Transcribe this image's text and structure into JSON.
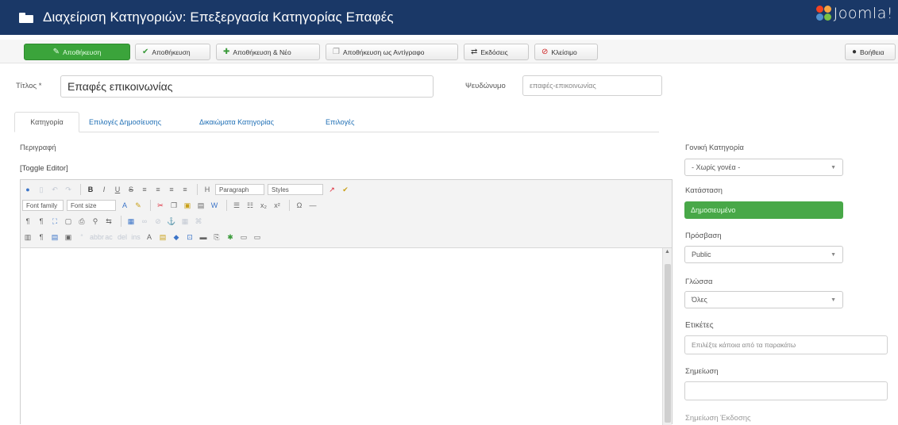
{
  "header": {
    "title": "Διαχείριση Κατηγοριών: Επεξεργασία Κατηγορίας Επαφές",
    "brand": "Joomla!"
  },
  "toolbar": {
    "save": "Αποθήκευση",
    "save_close": "Αποθήκευση",
    "save_new": "Αποθήκευση & Νέο",
    "save_copy": "Αποθήκευση ως Αντίγραφο",
    "versions": "Εκδόσεις",
    "close": "Κλείσιμο",
    "help": "Βοήθεια"
  },
  "form": {
    "title_label": "Τίτλος *",
    "title_value": "Επαφές επικοινωνίας",
    "alias_label": "Ψευδώνυμο",
    "alias_value": "επαφές-επικοινωνίας"
  },
  "tabs": [
    "Κατηγορία",
    "Επιλογές Δημοσίευσης",
    "Δικαιώματα Κατηγορίας",
    "Επιλογές"
  ],
  "editor": {
    "description_label": "Περιγραφή",
    "toggle_label": "[Toggle Editor]",
    "paragraph": "Paragraph",
    "styles": "Styles",
    "font_family": "Font family",
    "font_size": "Font size"
  },
  "sidebar": {
    "parent_label": "Γονική Κατηγορία",
    "parent_value": "- Χωρίς γονέα -",
    "status_label": "Κατάσταση",
    "status_value": "Δημοσιευμένο",
    "access_label": "Πρόσβαση",
    "access_value": "Public",
    "language_label": "Γλώσσα",
    "language_value": "Όλες",
    "tags_label": "Ετικέτες",
    "tags_placeholder": "Επιλέξτε κάποια από τα παρακάτω",
    "note_label": "Σημείωση",
    "version_note_label": "Σημείωση Έκδοσης"
  },
  "colors": {
    "header_bg": "#1a3867",
    "save_green": "#3ba43b",
    "link_blue": "#1f6fb5"
  }
}
